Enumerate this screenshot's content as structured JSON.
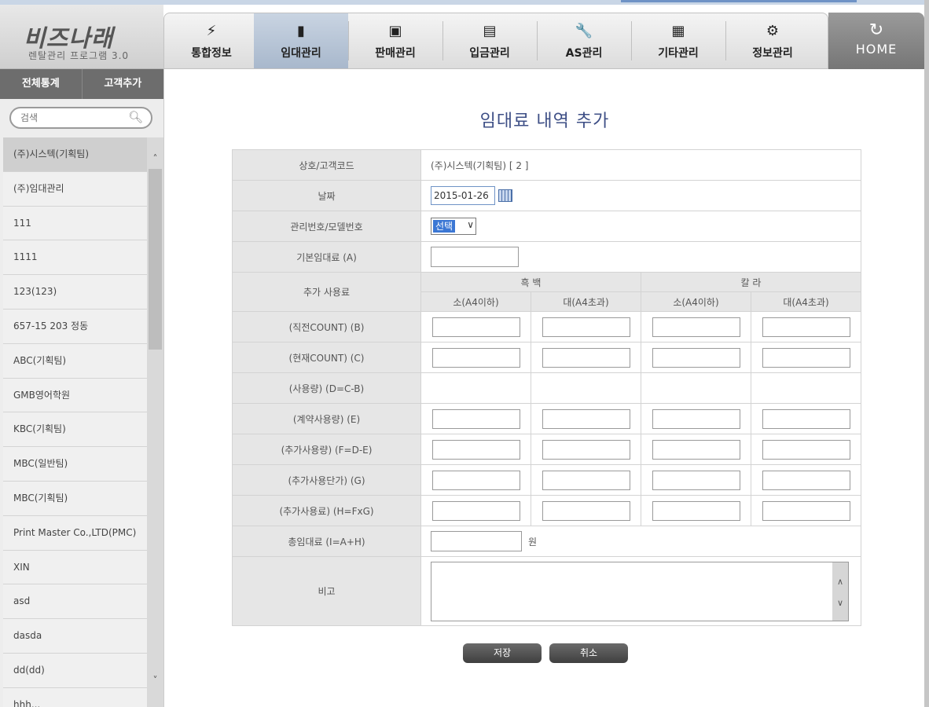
{
  "logo": {
    "title": "비즈나래",
    "subtitle": "렌탈관리 프로그램 3.0"
  },
  "menu": [
    {
      "label": "통합정보",
      "icon": "⚡",
      "icon_name": "lightning-icon"
    },
    {
      "label": "임대관리",
      "icon": "▮",
      "icon_name": "document-icon",
      "active": true
    },
    {
      "label": "판매관리",
      "icon": "▣",
      "icon_name": "folder-user-icon"
    },
    {
      "label": "입금관리",
      "icon": "▤",
      "icon_name": "folder-icon"
    },
    {
      "label": "AS관리",
      "icon": "🔧",
      "icon_name": "wrench-icon"
    },
    {
      "label": "기타관리",
      "icon": "▦",
      "icon_name": "folder-grid-icon"
    },
    {
      "label": "정보관리",
      "icon": "⚙",
      "icon_name": "gear-icon"
    }
  ],
  "home": {
    "label": "HOME",
    "icon": "↻"
  },
  "sidebar": {
    "buttons": [
      "전체통계",
      "고객추가"
    ],
    "search_placeholder": "검색",
    "customers": [
      "(주)시스텍(기획팀)",
      "(주)임대관리",
      "111",
      "1111",
      "123(123)",
      "657-15 203 정동",
      "ABC(기획팀)",
      "GMB영어학원",
      "KBC(기획팀)",
      "MBC(일반팀)",
      "MBC(기획팀)",
      "Print Master Co.,LTD(PMC)",
      "XIN",
      "asd",
      "dasda",
      "dd(dd)",
      "hhh..."
    ]
  },
  "form": {
    "title": "임대료 내역 추가",
    "labels": {
      "customer": "상호/고객코드",
      "date": "날짜",
      "model": "관리번호/모델번호",
      "base_fee": "기본임대료 (A)",
      "extra": "추가 사용료",
      "prev": "(직전COUNT) (B)",
      "curr": "(현재COUNT) (C)",
      "usage": "(사용량) (D=C-B)",
      "contract": "(계약사용량) (E)",
      "extra_usage": "(추가사용량) (F=D-E)",
      "unit_price": "(추가사용단가) (G)",
      "extra_fee": "(추가사용료) (H=FxG)",
      "total": "총임대료 (I=A+H)",
      "memo": "비고"
    },
    "groups": {
      "mono": "흑 백",
      "color": "칼 라"
    },
    "subcols": {
      "small": "소(A4이하)",
      "large": "대(A4초과)"
    },
    "customer_value": "(주)시스텍(기획팀)   [ 2 ]",
    "date_value": "2015-01-26",
    "model_select": "선택",
    "won": "원"
  },
  "buttons": {
    "save": "저장",
    "cancel": "취소"
  }
}
